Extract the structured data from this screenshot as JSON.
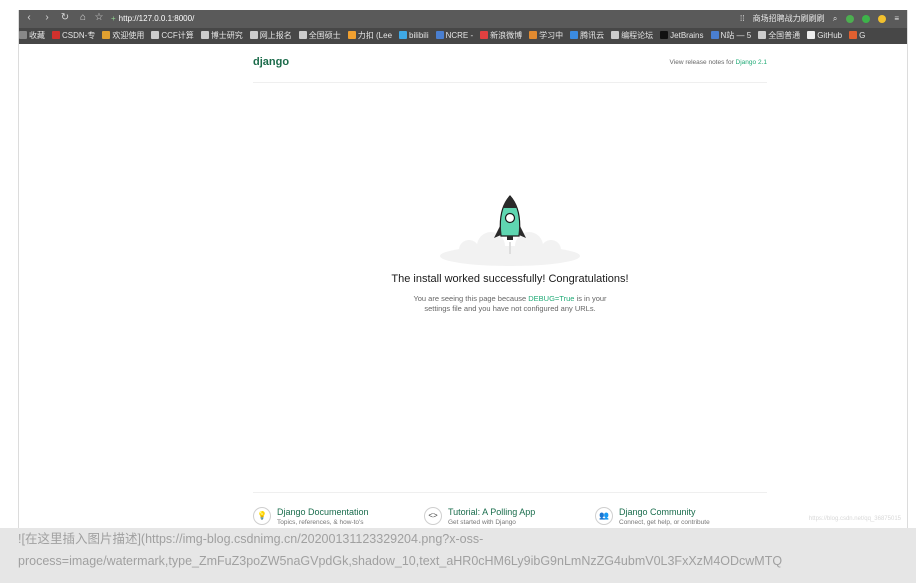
{
  "browser": {
    "address": "http://127.0.0.1:8000/",
    "search_text": "商场招聘战力刷刷刷",
    "bookmarks": [
      {
        "label": "收藏",
        "color": "#888888"
      },
      {
        "label": "CSDN-专",
        "color": "#d0312d"
      },
      {
        "label": "欢迎使用",
        "color": "#e0a030"
      },
      {
        "label": "CCF计算",
        "color": "#cccccc"
      },
      {
        "label": "博士研究",
        "color": "#cccccc"
      },
      {
        "label": "网上报名",
        "color": "#cccccc"
      },
      {
        "label": "全国硕士",
        "color": "#cccccc"
      },
      {
        "label": "力扣 (Lee",
        "color": "#f0a030"
      },
      {
        "label": "bilibili",
        "color": "#3fa9e6"
      },
      {
        "label": "NCRE -",
        "color": "#4a7fd0"
      },
      {
        "label": "新浪微博",
        "color": "#e04040"
      },
      {
        "label": "学习中",
        "color": "#e08a30"
      },
      {
        "label": "腾讯云",
        "color": "#3b8be0"
      },
      {
        "label": "编程论坛",
        "color": "#cccccc"
      },
      {
        "label": "JetBrains",
        "color": "#111111"
      },
      {
        "label": "N站 — 5",
        "color": "#4a7fd0"
      },
      {
        "label": "全国普通",
        "color": "#cccccc"
      },
      {
        "label": "GitHub",
        "color": "#eeeeee"
      },
      {
        "label": "G",
        "color": "#e06030"
      }
    ]
  },
  "django": {
    "logo": "django",
    "release_prefix": "View release notes for ",
    "release_link": "Django 2.1",
    "title": "The install worked successfully! Congratulations!",
    "desc_part1": "You are seeing this page because ",
    "desc_debug": "DEBUG=True",
    "desc_part2": " is in your settings file and you have not configured any URLs.",
    "footer": [
      {
        "icon": "lightbulb-icon",
        "glyph": "💡",
        "title": "Django Documentation",
        "sub": "Topics, references, & how-to's"
      },
      {
        "icon": "code-icon",
        "glyph": "<>",
        "title": "Tutorial: A Polling App",
        "sub": "Get started with Django"
      },
      {
        "icon": "people-icon",
        "glyph": "👥",
        "title": "Django Community",
        "sub": "Connect, get help, or contribute"
      }
    ],
    "watermark": "https://blog.csdn.net/qq_36875015"
  },
  "markdown": {
    "line1": "![在这里插入图片描述](https://img-blog.csdnimg.cn/20200131123329204.png?x-oss-",
    "line2": "process=image/watermark,type_ZmFuZ3poZW5naGVpdGk,shadow_10,text_aHR0cHM6Ly9ibG9nLmNzZG4ubmV0L3FxXzM4ODcwMTQ"
  },
  "colors": {
    "django_green": "#0c4b33",
    "link_green": "#20aa76",
    "rocket_body": "#5fd6b1"
  }
}
